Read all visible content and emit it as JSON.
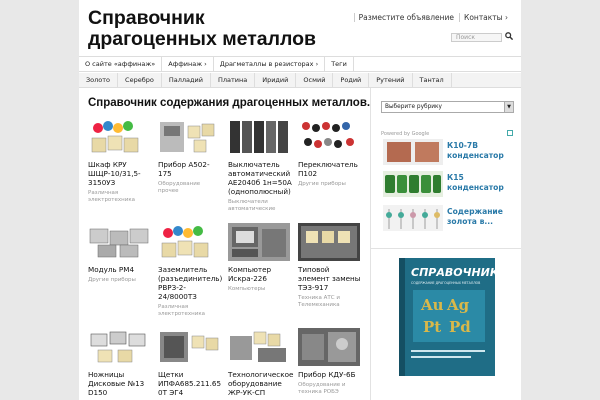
{
  "site": {
    "title_line1": "Справочник",
    "title_line2": "драгоценных металлов"
  },
  "top_links": [
    "Разместите объявление",
    "Контакты ›"
  ],
  "search": {
    "placeholder": "Поиск"
  },
  "nav_main": [
    "О сайте «аффинаж»",
    "Аффинаж ›",
    "Драгметаллы в резисторах ›",
    "Теги"
  ],
  "nav_metals": [
    "Золото",
    "Серебро",
    "Палладий",
    "Платина",
    "Иридий",
    "Осмий",
    "Родий",
    "Рутений",
    "Тантал"
  ],
  "section_title": "Справочник содержания драгоценных металлов.",
  "posts": [
    {
      "title": "Шкаф КРУ ШЩР-10/31,5-3150УЗ",
      "category": "Различная электротехника"
    },
    {
      "title": "Прибор А502-175",
      "category": "Оборудование прочее"
    },
    {
      "title": "Выключатель автоматический АЕ2040б 1н=50А (однополюсный)",
      "category": "Выключатели автоматические"
    },
    {
      "title": "Переключатель П102",
      "category": "Другие приборы"
    },
    {
      "title": "Модуль РМ4",
      "category": "Другие приборы"
    },
    {
      "title": "Заземлитель (разъединитель) РВРЗ-2-24/8000ТЗ",
      "category": "Различная электротехника"
    },
    {
      "title": "Компьютер Искра-226",
      "category": "Компьютеры"
    },
    {
      "title": "Типовой элемент замены ТЭЗ-917",
      "category": "Техника АТС и Телемеханика"
    },
    {
      "title": "Ножницы Дисковые №13 D150",
      "category": ""
    },
    {
      "title": "Щетки ИПФА685.211.65 0Т ЭГ4",
      "category": ""
    },
    {
      "title": "Технологическое оборудование ЖР-УК-СП",
      "category": ""
    },
    {
      "title": "Прибор КДУ-6Б",
      "category": "Оборудование и техника РОБЭ"
    }
  ],
  "sidebar": {
    "select_label": "Выберите рубрику",
    "powered_by": "Powered by Google",
    "ads": [
      {
        "line1": "К10-7В",
        "line2": "конденсатор"
      },
      {
        "line1": "К15",
        "line2": "конденсатор"
      },
      {
        "line1": "Содержание",
        "line2": "золота в..."
      }
    ],
    "book": {
      "title": "СПРАВОЧНИК",
      "subtitle": "СОДЕРЖАНИЕ ДРАГОЦЕННЫХ МЕТАЛЛОВ",
      "elements": [
        "Au",
        "Ag",
        "Pt",
        "Pd"
      ]
    }
  },
  "colors": {
    "link": "#2a7aa8",
    "book_cover": "#1f6d86",
    "book_gold": "#d9b84a"
  }
}
